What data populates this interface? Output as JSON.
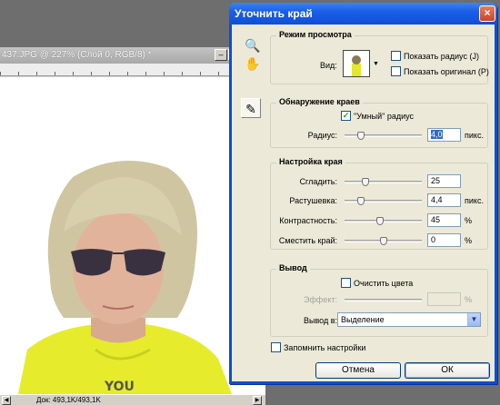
{
  "document": {
    "title": "437.JPG @ 227% (Слой 0, RGB/8) *",
    "status": "Док: 493,1K/493,1K"
  },
  "dialog": {
    "title": "Уточнить край",
    "view_mode": {
      "legend": "Режим просмотра",
      "view_label": "Вид:",
      "show_radius_label": "Показать радиус (J)",
      "show_radius_checked": false,
      "show_original_label": "Показать оригинал (P)",
      "show_original_checked": false
    },
    "edge_detection": {
      "legend": "Обнаружение краев",
      "smart_radius_label": "\"Умный\" радиус",
      "smart_radius_checked": true,
      "radius_label": "Радиус:",
      "radius_value": "4,0",
      "radius_unit": "пикс.",
      "radius_fraction": 0.18
    },
    "edge_adjust": {
      "legend": "Настройка края",
      "rows": [
        {
          "label": "Сгладить:",
          "value": "25",
          "unit": "",
          "fraction": 0.25
        },
        {
          "label": "Растушевка:",
          "value": "4,4",
          "unit": "пикс.",
          "fraction": 0.18
        },
        {
          "label": "Контрастность:",
          "value": "45",
          "unit": "%",
          "fraction": 0.45
        },
        {
          "label": "Сместить край:",
          "value": "0",
          "unit": "%",
          "fraction": 0.5
        }
      ]
    },
    "output": {
      "legend": "Вывод",
      "decontaminate_label": "Очистить цвета",
      "decontaminate_checked": false,
      "amount_label": "Эффект:",
      "amount_value": "",
      "amount_unit": "%",
      "output_to_label": "Вывод в:",
      "output_to_value": "Выделение"
    },
    "remember_label": "Запомнить настройки",
    "remember_checked": false,
    "cancel_label": "Отмена",
    "ok_label": "ОК"
  }
}
